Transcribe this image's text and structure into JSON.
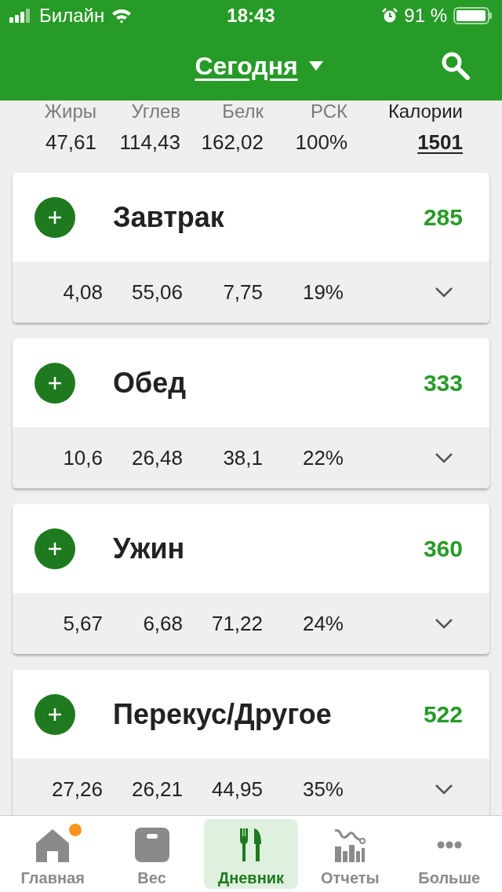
{
  "status_bar": {
    "carrier": "Билайн",
    "time": "18:43",
    "battery": "91 %"
  },
  "header": {
    "title": "Сегодня"
  },
  "summary": {
    "columns": [
      {
        "label": "Жиры",
        "value": "47,61"
      },
      {
        "label": "Углев",
        "value": "114,43"
      },
      {
        "label": "Белк",
        "value": "162,02"
      },
      {
        "label": "РСК",
        "value": "100%"
      }
    ],
    "calories": {
      "label": "Калории",
      "value": "1501"
    }
  },
  "meals": [
    {
      "name": "Завтрак",
      "calories": "285",
      "values": [
        "4,08",
        "55,06",
        "7,75",
        "19%"
      ]
    },
    {
      "name": "Обед",
      "calories": "333",
      "values": [
        "10,6",
        "26,48",
        "38,1",
        "22%"
      ]
    },
    {
      "name": "Ужин",
      "calories": "360",
      "values": [
        "5,67",
        "6,68",
        "71,22",
        "24%"
      ]
    },
    {
      "name": "Перекус/Другое",
      "calories": "522",
      "values": [
        "27,26",
        "26,21",
        "44,95",
        "35%"
      ]
    }
  ],
  "tab_bar": [
    {
      "label": "Главная",
      "kind": "home",
      "selected": false,
      "badge": true
    },
    {
      "label": "Вес",
      "kind": "scale",
      "selected": false,
      "badge": false
    },
    {
      "label": "Дневник",
      "kind": "diary",
      "selected": true,
      "badge": false
    },
    {
      "label": "Отчеты",
      "kind": "reports",
      "selected": false,
      "badge": false
    },
    {
      "label": "Больше",
      "kind": "more",
      "selected": false,
      "badge": false
    }
  ]
}
